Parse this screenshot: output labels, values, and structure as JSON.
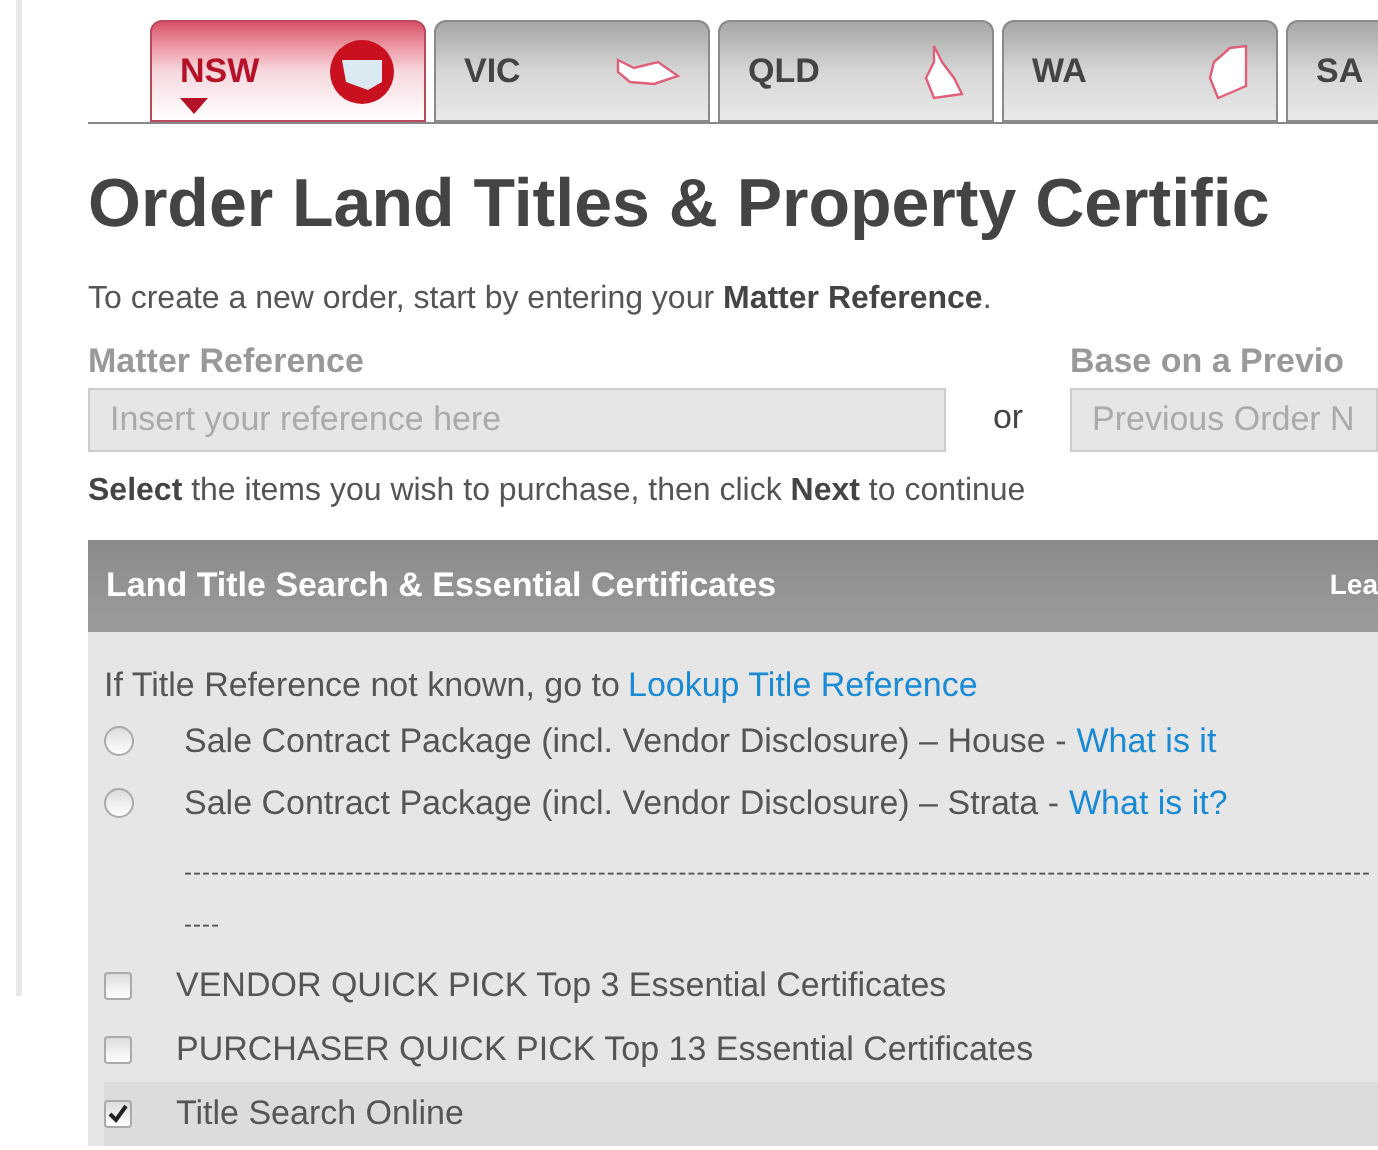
{
  "tabs": [
    {
      "label": "NSW",
      "selected": true
    },
    {
      "label": "VIC",
      "selected": false
    },
    {
      "label": "QLD",
      "selected": false
    },
    {
      "label": "WA",
      "selected": false
    },
    {
      "label": "SA",
      "selected": false
    }
  ],
  "title": "Order Land Titles & Property Certific",
  "intro": "To create a new order, start by entering your **Matter Reference**.",
  "matter_reference": {
    "label": "Matter Reference",
    "placeholder": "Insert your reference here"
  },
  "or": "or",
  "previous_order": {
    "label": "Base on a Previo",
    "placeholder": "Previous Order N"
  },
  "instruction": "**Select** the items you wish to purchase, then click **Next** to continue",
  "panel": {
    "title": "Land Title Search & Essential Certificates",
    "header_right": "Lea",
    "lookup_text": "If Title Reference not known, go to",
    "lookup_link": "Lookup Title Reference",
    "items": [
      {
        "kind": "radio",
        "label": "Sale Contract Package (incl. Vendor Disclosure) – House -",
        "link": "What is it",
        "checked": false
      },
      {
        "kind": "radio",
        "label": "Sale Contract Package (incl. Vendor Disclosure) – Strata -",
        "link": "What is it?",
        "checked": false
      },
      {
        "kind": "separator",
        "label": "----------------------------------------------------------------------------------------------------------------------------------------"
      },
      {
        "kind": "checkbox",
        "label": "VENDOR QUICK PICK Top 3 Essential Certificates",
        "checked": false
      },
      {
        "kind": "checkbox",
        "label": "PURCHASER QUICK PICK Top 13 Essential Certificates",
        "checked": false
      },
      {
        "kind": "checkbox",
        "label": "Title Search Online",
        "checked": true
      }
    ]
  }
}
